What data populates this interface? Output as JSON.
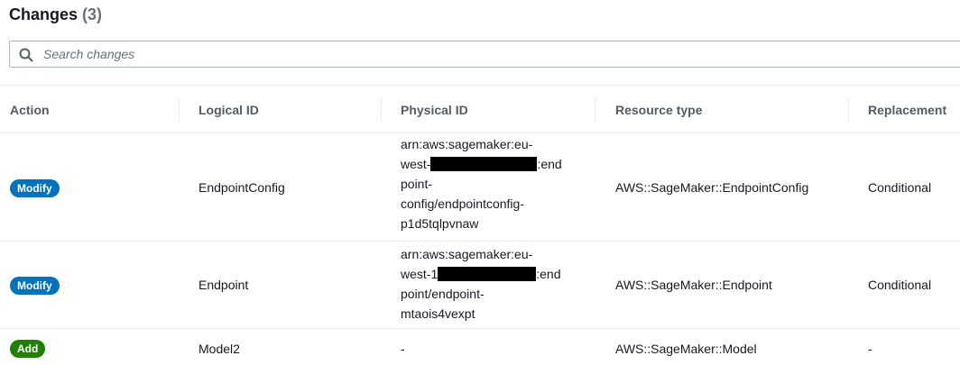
{
  "changes": {
    "title": "Changes",
    "count": "(3)"
  },
  "search": {
    "placeholder": "Search changes",
    "value": ""
  },
  "columns": [
    "Action",
    "Logical ID",
    "Physical ID",
    "Resource type",
    "Replacement"
  ],
  "colors": {
    "modify": "#0073bb",
    "add": "#1d8102",
    "border": "#eaeded"
  },
  "rows": [
    {
      "action": "Modify",
      "logical_id": "EndpointConfig",
      "physical_lines": [
        "arn:aws:sagemaker:eu-",
        "west-",
        ":end",
        "point-",
        "config/endpointconfig-",
        "p1d5tqlpvnaw"
      ],
      "resource_type": "AWS::SageMaker::EndpointConfig",
      "replacement": "Conditional"
    },
    {
      "action": "Modify",
      "logical_id": "Endpoint",
      "physical_lines": [
        "arn:aws:sagemaker:eu-",
        "west-1",
        ":end",
        "point/endpoint-",
        "mtaois4vexpt"
      ],
      "resource_type": "AWS::SageMaker::Endpoint",
      "replacement": "Conditional"
    },
    {
      "action": "Add",
      "logical_id": "Model2",
      "physical_id": "-",
      "resource_type": "AWS::SageMaker::Model",
      "replacement": "-"
    }
  ]
}
